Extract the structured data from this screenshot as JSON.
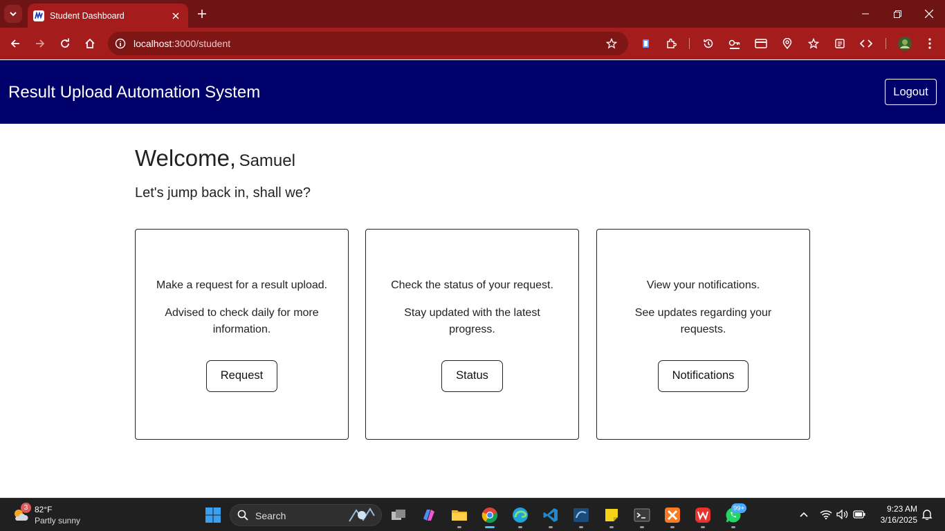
{
  "browser": {
    "tab": {
      "title": "Student Dashboard"
    },
    "url": {
      "host": "localhost",
      "path": ":3000/student"
    }
  },
  "app": {
    "title": "Result Upload Automation System",
    "logout_label": "Logout",
    "welcome_word": "Welcome,",
    "user_name": "Samuel",
    "subtitle": "Let's jump back in, shall we?",
    "cards": [
      {
        "line1": "Make a request for a result upload.",
        "line2": "Advised to check daily for more information.",
        "button": "Request"
      },
      {
        "line1": "Check the status of your request.",
        "line2": "Stay updated with the latest progress.",
        "button": "Status"
      },
      {
        "line1": "View your notifications.",
        "line2": "See updates regarding your requests.",
        "button": "Notifications"
      }
    ]
  },
  "taskbar": {
    "weather": {
      "temp": "82°F",
      "desc": "Partly sunny",
      "badge": "3"
    },
    "search_label": "Search",
    "whatsapp_badge": "99+",
    "clock": {
      "time": "9:23 AM",
      "date": "3/16/2025"
    }
  },
  "colors": {
    "chrome_frame": "#6e1414",
    "chrome_toolbar": "#a41c1c",
    "app_header": "#00006b"
  }
}
